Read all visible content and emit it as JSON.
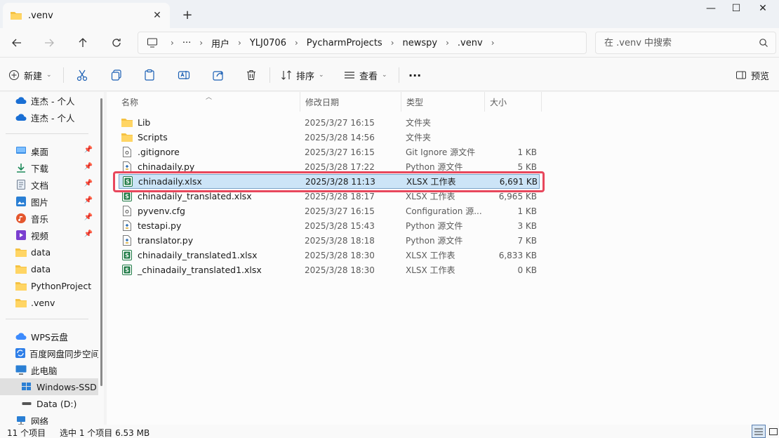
{
  "window": {
    "tab_title": ".venv",
    "new_tab_symbol": "+",
    "close_tab_symbol": "✕",
    "minimize_symbol": "—",
    "maximize_symbol": "☐",
    "close_symbol": "✕"
  },
  "address": {
    "overflow": "···",
    "breadcrumbs": [
      "用户",
      "YLJ0706",
      "PycharmProjects",
      "newspy",
      ".venv"
    ],
    "separator": "›"
  },
  "search": {
    "placeholder": "在 .venv 中搜索"
  },
  "toolbar": {
    "new_label": "新建",
    "sort_label": "排序",
    "view_label": "查看",
    "more_label": "···",
    "preview_label": "预览"
  },
  "sidebar": {
    "items": [
      {
        "label": "连杰 - 个人",
        "icon": "cloud-icon",
        "pinned": false
      },
      {
        "label": "连杰 - 个人",
        "icon": "cloud-icon",
        "pinned": false
      },
      {
        "label": "桌面",
        "icon": "desktop-icon",
        "pinned": true
      },
      {
        "label": "下载",
        "icon": "download-icon",
        "pinned": true
      },
      {
        "label": "文档",
        "icon": "document-icon",
        "pinned": true
      },
      {
        "label": "图片",
        "icon": "picture-icon",
        "pinned": true
      },
      {
        "label": "音乐",
        "icon": "music-icon",
        "pinned": true
      },
      {
        "label": "视频",
        "icon": "video-icon",
        "pinned": true
      },
      {
        "label": "data",
        "icon": "folder-icon",
        "pinned": false
      },
      {
        "label": "data",
        "icon": "folder-icon",
        "pinned": false
      },
      {
        "label": "PythonProject",
        "icon": "folder-icon",
        "pinned": false
      },
      {
        "label": ".venv",
        "icon": "folder-icon",
        "pinned": false
      },
      {
        "label": "WPS云盘",
        "icon": "wps-cloud-icon",
        "pinned": false
      },
      {
        "label": "百度网盘同步空间",
        "icon": "baidu-sync-icon",
        "pinned": false
      },
      {
        "label": "此电脑",
        "icon": "computer-icon",
        "pinned": false
      },
      {
        "label": "Windows-SSD",
        "icon": "windows-drive-icon",
        "pinned": false
      },
      {
        "label": "Data (D:)",
        "icon": "drive-icon",
        "pinned": false
      },
      {
        "label": "网络",
        "icon": "network-icon",
        "pinned": false
      }
    ]
  },
  "columns": {
    "name": "名称",
    "date": "修改日期",
    "type": "类型",
    "size": "大小"
  },
  "files": [
    {
      "name": "Lib",
      "date": "2025/3/27 16:15",
      "type": "文件夹",
      "size": "",
      "icon": "folder-icon"
    },
    {
      "name": "Scripts",
      "date": "2025/3/28 14:56",
      "type": "文件夹",
      "size": "",
      "icon": "folder-icon"
    },
    {
      "name": ".gitignore",
      "date": "2025/3/27 16:15",
      "type": "Git Ignore 源文件",
      "size": "1 KB",
      "icon": "text-file-icon"
    },
    {
      "name": "chinadaily.py",
      "date": "2025/3/28 17:22",
      "type": "Python 源文件",
      "size": "5 KB",
      "icon": "python-file-icon"
    },
    {
      "name": "chinadaily.xlsx",
      "date": "2025/3/28 11:13",
      "type": "XLSX 工作表",
      "size": "6,691 KB",
      "icon": "spreadsheet-icon"
    },
    {
      "name": "chinadaily_translated.xlsx",
      "date": "2025/3/28 18:17",
      "type": "XLSX 工作表",
      "size": "6,965 KB",
      "icon": "spreadsheet-icon"
    },
    {
      "name": "pyvenv.cfg",
      "date": "2025/3/27 16:15",
      "type": "Configuration 源...",
      "size": "1 KB",
      "icon": "config-file-icon"
    },
    {
      "name": "testapi.py",
      "date": "2025/3/28 15:43",
      "type": "Python 源文件",
      "size": "3 KB",
      "icon": "python-file-icon"
    },
    {
      "name": "translator.py",
      "date": "2025/3/28 18:18",
      "type": "Python 源文件",
      "size": "7 KB",
      "icon": "python-file-icon"
    },
    {
      "name": "chinadaily_translated1.xlsx",
      "date": "2025/3/28 18:30",
      "type": "XLSX 工作表",
      "size": "6,833 KB",
      "icon": "spreadsheet-icon"
    },
    {
      "name": "_chinadaily_translated1.xlsx",
      "date": "2025/3/28 18:30",
      "type": "XLSX 工作表",
      "size": "0 KB",
      "icon": "spreadsheet-icon"
    }
  ],
  "selected_file": "chinadaily.xlsx",
  "status": {
    "item_count": "11 个项目",
    "selection": "选中 1 个项目  6.53 MB"
  },
  "colors": {
    "selection_bg": "#cce4f7",
    "highlight_border": "#e8475c",
    "folder": "#f5c242",
    "excel_green": "#1e7a45"
  }
}
